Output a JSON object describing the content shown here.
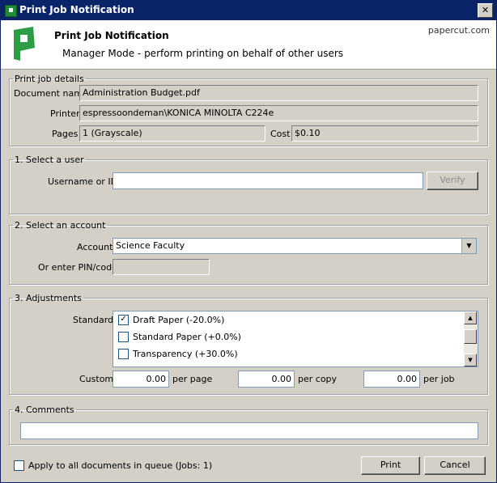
{
  "window": {
    "title": "Print Job Notification"
  },
  "header": {
    "title": "Print Job Notification",
    "subtitle": "Manager Mode - perform printing on behalf of other users",
    "brand": "papercut.com"
  },
  "job_details": {
    "legend": "Print job details",
    "document_label": "Document name",
    "document_value": "Administration Budget.pdf",
    "printer_label": "Printer",
    "printer_value": "espressoondeman\\KONICA MINOLTA C224e",
    "pages_label": "Pages",
    "pages_value": "1   (Grayscale)",
    "cost_label": "Cost",
    "cost_value": "$0.10"
  },
  "select_user": {
    "legend": "1. Select a user",
    "username_label": "Username or ID",
    "username_value": "",
    "verify_label": "Verify"
  },
  "select_account": {
    "legend": "2. Select an account",
    "account_label": "Account",
    "account_value": "Science Faculty",
    "pin_label": "Or enter PIN/code",
    "pin_value": ""
  },
  "adjustments": {
    "legend": "3. Adjustments",
    "standard_label": "Standard",
    "options": [
      {
        "label": "Draft Paper (-20.0%)",
        "checked": true
      },
      {
        "label": "Standard Paper (+0.0%)",
        "checked": false
      },
      {
        "label": "Transparency (+30.0%)",
        "checked": false
      }
    ],
    "custom_label": "Custom",
    "per_page_value": "0.00",
    "per_page_label": "per page",
    "per_copy_value": "0.00",
    "per_copy_label": "per copy",
    "per_job_value": "0.00",
    "per_job_label": "per job"
  },
  "comments": {
    "legend": "4. Comments",
    "value": ""
  },
  "footer": {
    "apply_all_label": "Apply to all documents in queue (Jobs: 1)",
    "apply_all_checked": false,
    "print_label": "Print",
    "cancel_label": "Cancel"
  },
  "colors": {
    "titlebar": "#0a246a",
    "dialog_bg": "#d4d0c8",
    "logo_green": "#2e9b45"
  }
}
